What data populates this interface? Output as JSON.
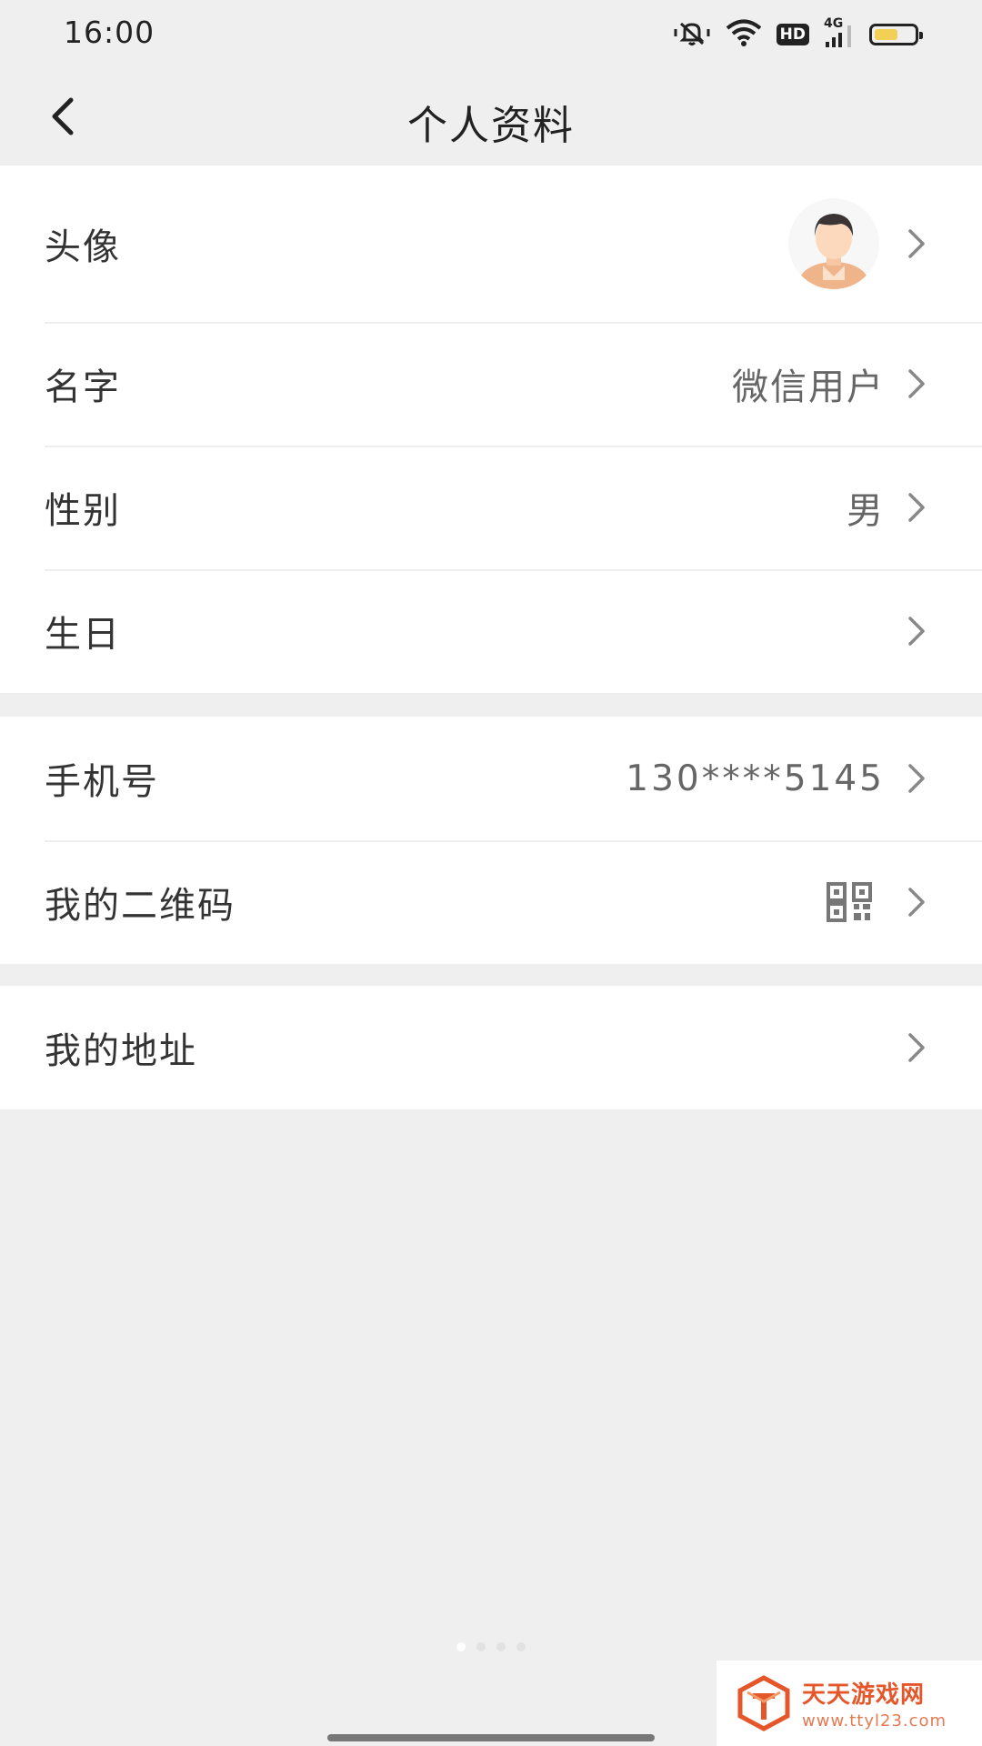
{
  "status_bar": {
    "time": "16:00",
    "hd_label": "HD",
    "network_label": "4G",
    "battery_level": 0.6,
    "icons": [
      "mute-bell-icon",
      "wifi-icon",
      "hd-icon",
      "signal-4g-icon",
      "battery-icon"
    ]
  },
  "nav": {
    "title": "个人资料",
    "back_icon": "chevron-left-icon"
  },
  "profile": {
    "avatar_label": "头像",
    "name_label": "名字",
    "name_value": "微信用户",
    "gender_label": "性别",
    "gender_value": "男",
    "birthday_label": "生日",
    "birthday_value": ""
  },
  "account": {
    "phone_label": "手机号",
    "phone_value": "130****5145",
    "qrcode_label": "我的二维码",
    "qrcode_icon": "qrcode-icon"
  },
  "address": {
    "address_label": "我的地址"
  },
  "watermark": {
    "name": "天天游戏网",
    "url": "www.ttyl23.com"
  },
  "colors": {
    "background": "#efefef",
    "card": "#ffffff",
    "label": "#333333",
    "value": "#666666",
    "chevron": "#888888",
    "watermark": "#e5572a"
  }
}
